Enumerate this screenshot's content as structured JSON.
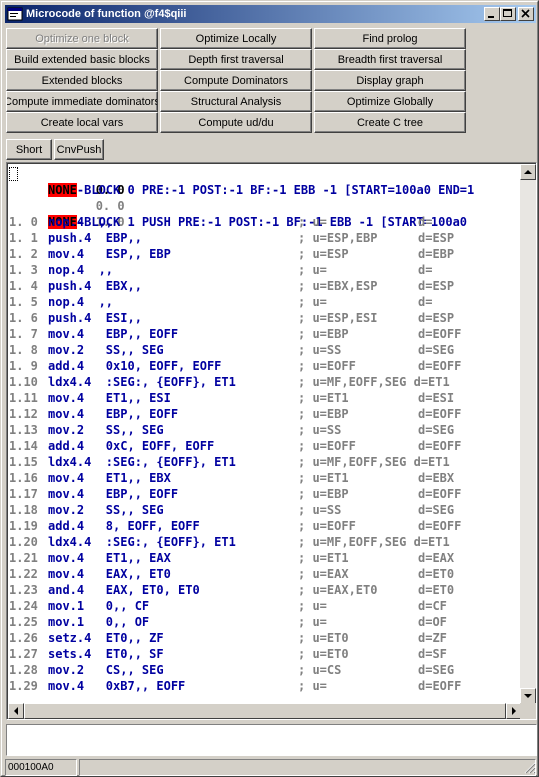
{
  "window": {
    "title": "Microcode of function @f4$qiii"
  },
  "toolbar": {
    "buttons": [
      {
        "label": "Optimize one block",
        "disabled": true
      },
      {
        "label": "Optimize Locally"
      },
      {
        "label": "Find prolog"
      },
      {
        "label": "Build extended basic blocks"
      },
      {
        "label": "Depth first traversal"
      },
      {
        "label": "Breadth first traversal"
      },
      {
        "label": "Extended blocks"
      },
      {
        "label": "Compute Dominators"
      },
      {
        "label": "Display graph"
      },
      {
        "label": "Compute immediate dominators"
      },
      {
        "label": "Structural Analysis"
      },
      {
        "label": "Optimize Globally"
      },
      {
        "label": "Create local vars"
      },
      {
        "label": "Compute ud/du"
      },
      {
        "label": "Create C tree"
      }
    ],
    "short_label": "Short",
    "cnvpush_label": "CnvPush"
  },
  "code": {
    "header_lines": [
      {
        "num": "0. 0",
        "tag": "NONE",
        "text": "-BLOCK 0 PRE:-1 POST:-1 BF:-1 EBB -1 [START=100a0 END=1"
      },
      {
        "num": "0. 0",
        "tag": "",
        "text": ""
      },
      {
        "num": "1. 0",
        "tag": "NONE",
        "text": "-BLOCK 1 PUSH PRE:-1 POST:-1 BF:-1 EBB -1 [START=100a0"
      }
    ],
    "lines": [
      {
        "num": "1. 0",
        "ins": "nop.4  ,,",
        "u": "; u=",
        "d": "d="
      },
      {
        "num": "1. 1",
        "ins": "push.4  EBP,,",
        "u": "; u=ESP,EBP",
        "d": "d=ESP"
      },
      {
        "num": "1. 2",
        "ins": "mov.4   ESP,, EBP",
        "u": "; u=ESP",
        "d": "d=EBP"
      },
      {
        "num": "1. 3",
        "ins": "nop.4  ,,",
        "u": "; u=",
        "d": "d="
      },
      {
        "num": "1. 4",
        "ins": "push.4  EBX,,",
        "u": "; u=EBX,ESP",
        "d": "d=ESP"
      },
      {
        "num": "1. 5",
        "ins": "nop.4  ,,",
        "u": "; u=",
        "d": "d="
      },
      {
        "num": "1. 6",
        "ins": "push.4  ESI,,",
        "u": "; u=ESP,ESI",
        "d": "d=ESP"
      },
      {
        "num": "1. 7",
        "ins": "mov.4   EBP,, EOFF",
        "u": "; u=EBP",
        "d": "d=EOFF"
      },
      {
        "num": "1. 8",
        "ins": "mov.2   SS,, SEG",
        "u": "; u=SS",
        "d": "d=SEG"
      },
      {
        "num": "1. 9",
        "ins": "add.4   0x10, EOFF, EOFF",
        "u": "; u=EOFF",
        "d": "d=EOFF"
      },
      {
        "num": "1.10",
        "ins": "ldx4.4  :SEG:, {EOFF}, ET1",
        "u": "; u=MF,EOFF,SEG d=ET1",
        "d": ""
      },
      {
        "num": "1.11",
        "ins": "mov.4   ET1,, ESI",
        "u": "; u=ET1",
        "d": "d=ESI"
      },
      {
        "num": "1.12",
        "ins": "mov.4   EBP,, EOFF",
        "u": "; u=EBP",
        "d": "d=EOFF"
      },
      {
        "num": "1.13",
        "ins": "mov.2   SS,, SEG",
        "u": "; u=SS",
        "d": "d=SEG"
      },
      {
        "num": "1.14",
        "ins": "add.4   0xC, EOFF, EOFF",
        "u": "; u=EOFF",
        "d": "d=EOFF"
      },
      {
        "num": "1.15",
        "ins": "ldx4.4  :SEG:, {EOFF}, ET1",
        "u": "; u=MF,EOFF,SEG d=ET1",
        "d": ""
      },
      {
        "num": "1.16",
        "ins": "mov.4   ET1,, EBX",
        "u": "; u=ET1",
        "d": "d=EBX"
      },
      {
        "num": "1.17",
        "ins": "mov.4   EBP,, EOFF",
        "u": "; u=EBP",
        "d": "d=EOFF"
      },
      {
        "num": "1.18",
        "ins": "mov.2   SS,, SEG",
        "u": "; u=SS",
        "d": "d=SEG"
      },
      {
        "num": "1.19",
        "ins": "add.4   8, EOFF, EOFF",
        "u": "; u=EOFF",
        "d": "d=EOFF"
      },
      {
        "num": "1.20",
        "ins": "ldx4.4  :SEG:, {EOFF}, ET1",
        "u": "; u=MF,EOFF,SEG d=ET1",
        "d": ""
      },
      {
        "num": "1.21",
        "ins": "mov.4   ET1,, EAX",
        "u": "; u=ET1",
        "d": "d=EAX"
      },
      {
        "num": "1.22",
        "ins": "mov.4   EAX,, ET0",
        "u": "; u=EAX",
        "d": "d=ET0"
      },
      {
        "num": "1.23",
        "ins": "and.4   EAX, ET0, ET0",
        "u": "; u=EAX,ET0",
        "d": "d=ET0"
      },
      {
        "num": "1.24",
        "ins": "mov.1   0,, CF",
        "u": "; u=",
        "d": "d=CF"
      },
      {
        "num": "1.25",
        "ins": "mov.1   0,, OF",
        "u": "; u=",
        "d": "d=OF"
      },
      {
        "num": "1.26",
        "ins": "setz.4  ET0,, ZF",
        "u": "; u=ET0",
        "d": "d=ZF"
      },
      {
        "num": "1.27",
        "ins": "sets.4  ET0,, SF",
        "u": "; u=ET0",
        "d": "d=SF"
      },
      {
        "num": "1.28",
        "ins": "mov.2   CS,, SEG",
        "u": "; u=CS",
        "d": "d=SEG"
      },
      {
        "num": "1.29",
        "ins": "mov.4   0xB7,, EOFF",
        "u": "; u=",
        "d": "d=EOFF"
      }
    ]
  },
  "statusbar": {
    "address": "000100A0",
    "message": ""
  },
  "colors": {
    "title_start": "#0a246a",
    "title_end": "#a6caf0",
    "instruction": "#0000a0",
    "none_tag": "#ff0000"
  }
}
